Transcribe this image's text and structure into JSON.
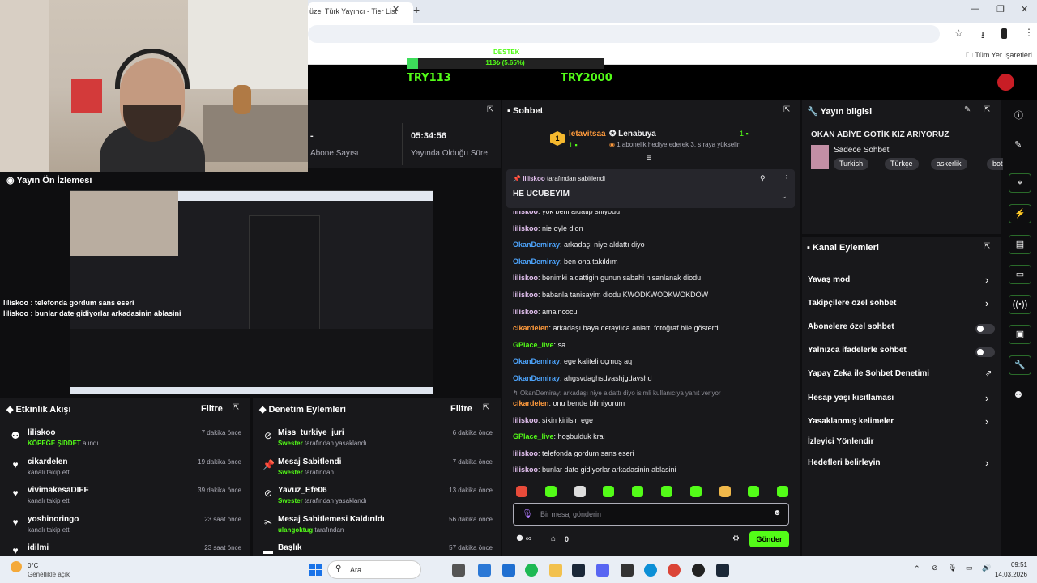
{
  "browser": {
    "tab_title": "üzel Türk Yayıncı - Tier List",
    "bookmarks_label": "Tüm Yer İşaretleri"
  },
  "banner": {
    "goal_label": "DESTEK",
    "goal_text": "113₺ (5.65%)",
    "goal_fraction": 0.0565,
    "current": "TRY113",
    "target": "TRY2000"
  },
  "stats": {
    "stat1_value": "-",
    "stat1_label": "Abone Sayısı",
    "stat2_value": "05:34:56",
    "stat2_label": "Yayında Olduğu Süre"
  },
  "preview": {
    "title": "Yayın Ön İzlemesi",
    "overlay_line1": "liliskoo : telefonda gordum sans eseri",
    "overlay_line2": "liliskoo : bunlar date gidiyorlar arkadasinin ablasini"
  },
  "chat": {
    "title": "Sohbet",
    "leader1_name": "letavitsaa",
    "leader1_rank": "1",
    "leader1_count": "1",
    "leader2_name": "Lenabuya",
    "leader2_count": "1",
    "leader2_text": "1 abonelik hediye ederek 3. sıraya yükselin",
    "pinned_by_user": "liliskoo",
    "pinned_by_suffix": "tarafından sabitlendi",
    "pinned_message": "HE UCUBEYIM",
    "messages": [
      {
        "user": "liliskoo",
        "text": "yok beni aldatip sniyodu",
        "color": "pink"
      },
      {
        "user": "liliskoo",
        "text": "nie oyle dion",
        "color": "pink"
      },
      {
        "user": "OkanDemiray",
        "text": "arkadaşı niye aldattı diyo",
        "color": "blue"
      },
      {
        "user": "OkanDemiray",
        "text": "ben ona takıldım",
        "color": "blue"
      },
      {
        "user": "liliskoo",
        "text": "benimki aldattigin gunun sabahi nisanlanak diodu",
        "color": "pink"
      },
      {
        "user": "liliskoo",
        "text": "babanla tanisayim diodu KWODKWODKWOKDOW",
        "color": "pink"
      },
      {
        "user": "liliskoo",
        "text": "amaincocu",
        "color": "pink"
      },
      {
        "user": "cikardelen",
        "text": "arkadaşı baya detaylıca anlattı fotoğraf bile gösterdi",
        "color": "orange"
      },
      {
        "user": "GPlace_live",
        "text": "sa",
        "color": "green"
      },
      {
        "user": "OkanDemiray",
        "text": "ege kaliteli oçmuş aq",
        "color": "blue"
      },
      {
        "user": "OkanDemiray",
        "text": "ahgsvdaghsdvashjgdavshd",
        "color": "blue"
      }
    ],
    "reply_ref": "OkanDemiray: arkadaşı niye aldattı diyo isimli kullanıcıya yanıt veriyor",
    "messages2": [
      {
        "user": "cikardelen",
        "text": "onu bende bilmiyorum",
        "color": "orange"
      },
      {
        "user": "liliskoo",
        "text": "sikin kirilsin ege",
        "color": "pink"
      },
      {
        "user": "GPlace_live",
        "text": "hoşbulduk kral",
        "color": "green"
      },
      {
        "user": "liliskoo",
        "text": "telefonda gordum sans eseri",
        "color": "pink"
      },
      {
        "user": "liliskoo",
        "text": "bunlar date gidiyorlar arkadasinin ablasini",
        "color": "pink"
      }
    ],
    "input_placeholder": "Bir mesaj gönderin",
    "footer_count": "0",
    "send_label": "Gönder"
  },
  "stream_info": {
    "title": "Yayın bilgisi",
    "stream_title": "OKAN ABİYE GOTİK KIZ ARIYORUZ",
    "category": "Sadece Sohbet",
    "tags": [
      "Turkish",
      "Türkçe",
      "askerlik",
      "botpre"
    ]
  },
  "channel_actions": {
    "title": "Kanal Eylemleri",
    "items": [
      "Yavaş mod",
      "Takipçilere özel sohbet",
      "Abonelere özel sohbet",
      "Yalnızca ifadelerle sohbet",
      "Yapay Zeka ile Sohbet Denetimi",
      "Hesap yaşı kısıtlaması",
      "Yasaklanmış kelimeler",
      "İzleyici Yönlendir",
      "Hedefleri belirleyin"
    ]
  },
  "activity": {
    "title": "Etkinlik Akışı",
    "filter_label": "Filtre",
    "events": [
      {
        "name": "liliskoo",
        "sub_highlight": "KÖPEĞE ŞİDDET",
        "sub": "alındı",
        "time": "7 dakika önce"
      },
      {
        "name": "cikardelen",
        "sub_highlight": "",
        "sub": "kanalı takip etti",
        "time": "19 dakika önce"
      },
      {
        "name": "vivimakesaDIFF",
        "sub_highlight": "",
        "sub": "kanalı takip etti",
        "time": "39 dakika önce"
      },
      {
        "name": "yoshinoringo",
        "sub_highlight": "",
        "sub": "kanalı takip etti",
        "time": "23 saat önce"
      },
      {
        "name": "idilmi",
        "sub_highlight": "",
        "sub": "",
        "time": "23 saat önce"
      }
    ]
  },
  "moderation": {
    "title": "Denetim Eylemleri",
    "filter_label": "Filtre",
    "events": [
      {
        "name": "Miss_turkiye_juri",
        "sub_highlight": "Swester",
        "sub": "tarafından yasaklandı",
        "time": "6 dakika önce"
      },
      {
        "name": "Mesaj Sabitlendi",
        "sub_highlight": "Swester",
        "sub": "tarafından",
        "time": "7 dakika önce"
      },
      {
        "name": "Yavuz_Efe06",
        "sub_highlight": "Swester",
        "sub": "tarafından yasaklandı",
        "time": "13 dakika önce"
      },
      {
        "name": "Mesaj Sabitlemesi Kaldırıldı",
        "sub_highlight": "ulangoktug",
        "sub": "tarafından",
        "time": "56 dakika önce"
      },
      {
        "name": "Başlık",
        "sub_highlight": "",
        "sub": "",
        "time": "57 dakika önce"
      }
    ]
  },
  "taskbar": {
    "weather_temp": "0°C",
    "weather_desc": "Genellikle açık",
    "search_label": "Ara",
    "time": "09:51",
    "date": "14.03.2026"
  }
}
